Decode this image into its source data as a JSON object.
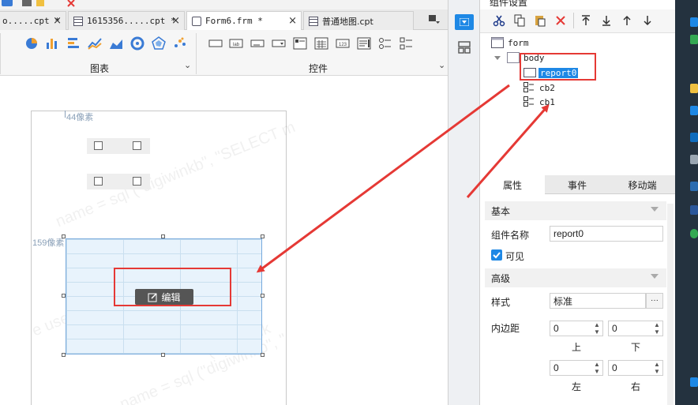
{
  "tabs": [
    {
      "label": "o.....cpt *",
      "close": "×"
    },
    {
      "label": "1615356.....cpt *",
      "close": "×"
    },
    {
      "label": "Form6.frm *",
      "close": "×",
      "active": true
    },
    {
      "label": "普通地图.cpt",
      "close": "×"
    }
  ],
  "toolbar": {
    "group_chart": "图表",
    "group_controls": "控件",
    "chevron": "⌄"
  },
  "canvas": {
    "label_44": "44像素",
    "label_159": "159像素",
    "edit_button": "编辑",
    "watermark_1": "name = sql (\"digiwinkb\", \"SELECT m",
    "watermark_2": "e use",
    "watermark_3": "name = sql (\"digiwinkb\", \"",
    "watermark_4": "(\"digiwink"
  },
  "panel": {
    "title_partial": "组件设置",
    "tree": [
      {
        "label": "form",
        "level": 0
      },
      {
        "label": "body",
        "level": 1
      },
      {
        "label": "report0",
        "level": 2,
        "selected": true
      },
      {
        "label": "cb2",
        "level": 2
      },
      {
        "label": "cb1",
        "level": 2
      }
    ],
    "tabs": [
      "属性",
      "事件",
      "移动端"
    ],
    "section_basic": "基本",
    "section_advanced": "高级",
    "field_name_label": "组件名称",
    "field_name_value": "report0",
    "visible_label": "可见",
    "visible_checked": true,
    "style_label": "样式",
    "style_value": "标准",
    "style_more": "···",
    "padding_label": "内边距",
    "padding": {
      "top": {
        "value": "0",
        "label": "上"
      },
      "bottom": {
        "value": "0",
        "label": "下"
      },
      "left": {
        "value": "0",
        "label": "左"
      },
      "right": {
        "value": "0",
        "label": "右"
      }
    }
  },
  "colors": {
    "accent": "#1e88e5",
    "annotation_red": "#e53935",
    "report_fill": "#e8f3fc"
  }
}
